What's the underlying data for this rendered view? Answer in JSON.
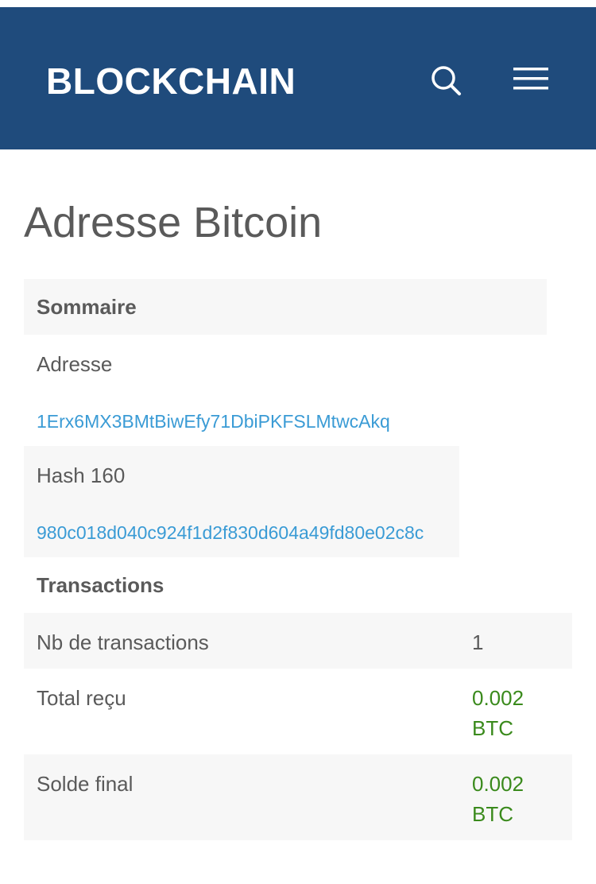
{
  "header": {
    "logo": "BLOCKCHAIN",
    "search_icon": "search-icon",
    "menu_icon": "hamburger-menu-icon",
    "bg_color": "#1f4b7c"
  },
  "page": {
    "title": "Adresse Bitcoin"
  },
  "summary": {
    "heading": "Sommaire",
    "address_label": "Adresse",
    "address_value": "1Erx6MX3BMtBiwEfy71DbiPKFSLMtwcAkq",
    "hash_label": "Hash 160",
    "hash_value": "980c018d040c924f1d2f830d604a49fd80e02c8c"
  },
  "transactions": {
    "heading": "Transactions",
    "rows": [
      {
        "label": "Nb de transactions",
        "value": "1"
      },
      {
        "label": "Total reçu",
        "value": "0.002 BTC"
      },
      {
        "label": "Solde final",
        "value": "0.002 BTC"
      }
    ]
  },
  "colors": {
    "link": "#3a9bd5",
    "positive": "#3a8a1c",
    "text": "#5a5a5a"
  }
}
